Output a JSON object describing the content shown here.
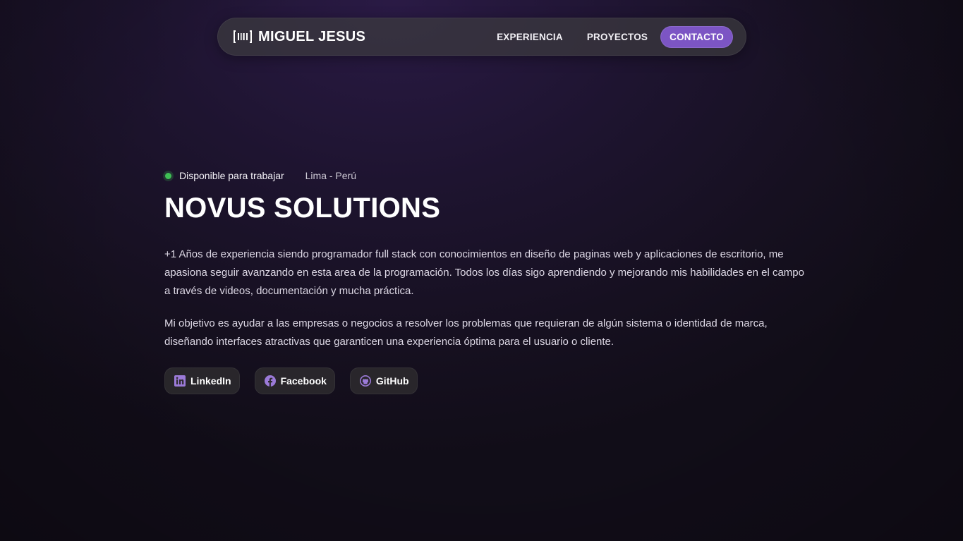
{
  "navbar": {
    "brand_icon": "barcode-icon",
    "brand_name": "MIGUEL JESUS",
    "links": [
      {
        "label": "EXPERIENCIA"
      },
      {
        "label": "PROYECTOS"
      }
    ],
    "cta_label": "CONTACTO"
  },
  "hero": {
    "status_text": "Disponible para trabajar",
    "location": "Lima - Perú",
    "title": "NOVUS SOLUTIONS",
    "paragraph_1": "+1 Años de experiencia siendo programador full stack con conocimientos en diseño de paginas web y aplicaciones de escritorio, me apasiona seguir avanzando en esta area de la programación. Todos los días sigo aprendiendo y mejorando mis habilidades en el campo a través de videos, documentación y mucha práctica.",
    "paragraph_2": "Mi objetivo es ayudar a las empresas o negocios a resolver los problemas que requieran de algún sistema o identidad de marca, diseñando interfaces atractivas que garanticen una experiencia óptima para el usuario o cliente."
  },
  "socials": [
    {
      "label": "LinkedIn",
      "icon": "linkedin-icon"
    },
    {
      "label": "Facebook",
      "icon": "facebook-icon"
    },
    {
      "label": "GitHub",
      "icon": "github-icon"
    }
  ],
  "colors": {
    "accent": "#7c55c4",
    "icon_accent": "#9b7ad8",
    "status_green": "#3fbf55",
    "background": "#1a1226"
  }
}
